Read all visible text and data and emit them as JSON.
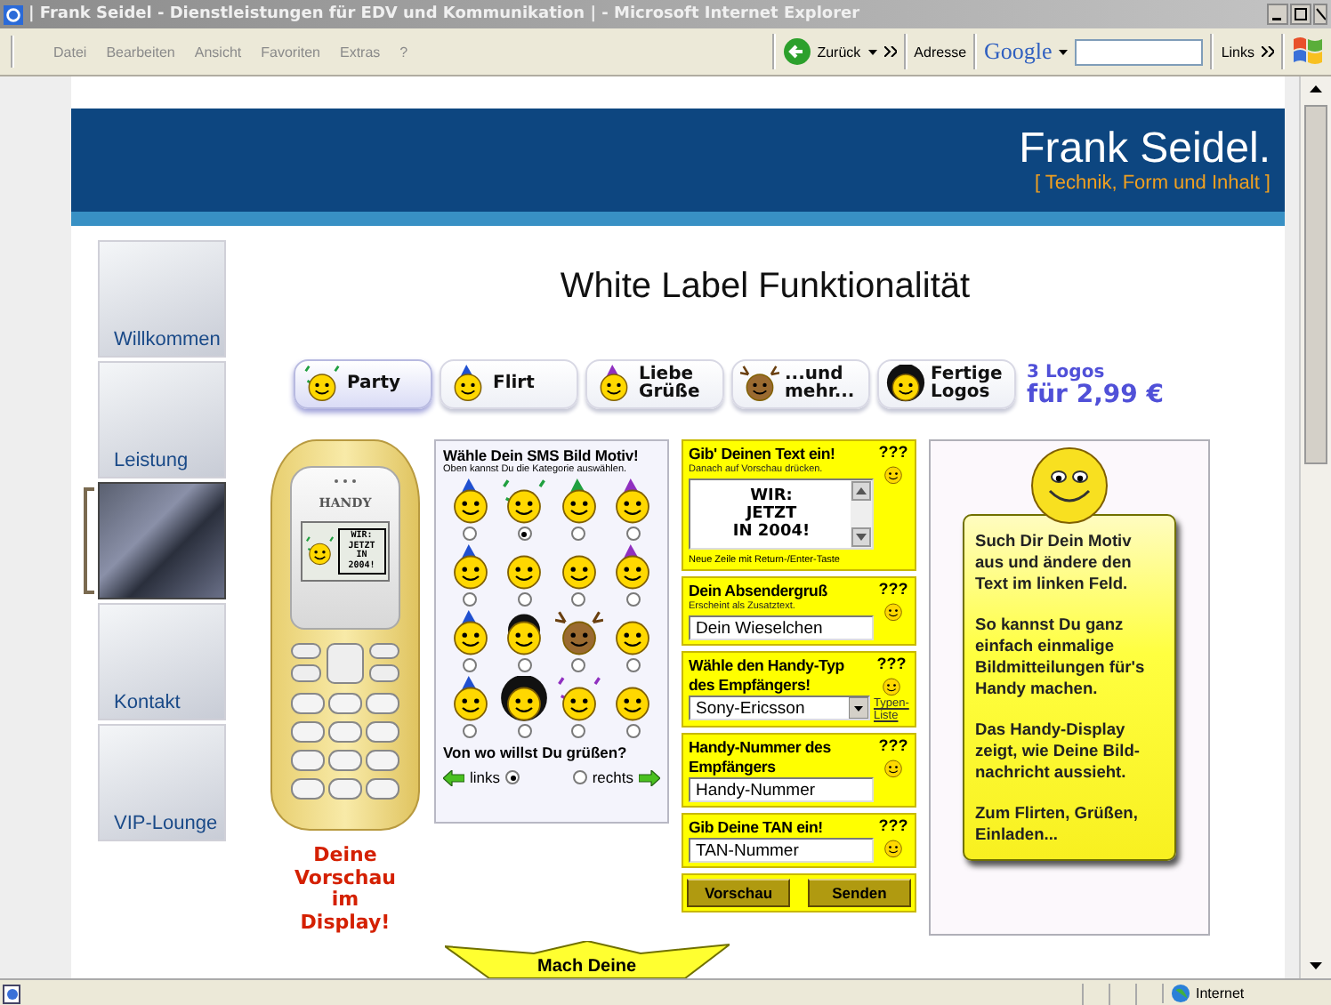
{
  "window": {
    "title": "| Frank Seidel - Dienstleistungen für EDV und Kommunikation | - Microsoft Internet Explorer"
  },
  "menu": [
    "Datei",
    "Bearbeiten",
    "Ansicht",
    "Favoriten",
    "Extras",
    "?"
  ],
  "toolbar": {
    "back": "Zurück",
    "address_label": "Adresse",
    "search_brand": "Google",
    "links": "Links"
  },
  "header": {
    "title": "Frank Seidel.",
    "tagline": "[ Technik, Form und Inhalt ]"
  },
  "nav": [
    {
      "label": "Willkommen",
      "selected": false
    },
    {
      "label": "Leistung",
      "selected": false
    },
    {
      "selected": true
    },
    {
      "label": "Kontakt",
      "selected": false
    },
    {
      "label": "VIP-Lounge",
      "selected": false
    }
  ],
  "heading": "White Label Funktionalität",
  "tabs": [
    {
      "label": "Party",
      "selected": true
    },
    {
      "label": "Flirt",
      "selected": false
    },
    {
      "label": "Liebe\nGrüße",
      "selected": false
    },
    {
      "label": "...und\nmehr...",
      "selected": false
    },
    {
      "label": "Fertige\nLogos",
      "selected": false
    }
  ],
  "offer": {
    "line_1": "3 Logos",
    "line_2": "für 2,99 €"
  },
  "phone": {
    "brand": "HANDY",
    "screen_text": "WIR:\nJETZT\nIN 2004!",
    "caption": "Deine\nVorschau\nim\nDisplay!"
  },
  "motif": {
    "title": "Wähle Dein SMS Bild Motiv!",
    "hint": "Oben kannst Du die Kategorie auswählen.",
    "options": [
      {
        "selected": false
      },
      {
        "selected": true
      },
      {
        "selected": false
      },
      {
        "selected": false
      },
      {
        "selected": false
      },
      {
        "selected": false
      },
      {
        "selected": false
      },
      {
        "selected": false
      },
      {
        "selected": false
      },
      {
        "selected": false
      },
      {
        "selected": false
      },
      {
        "selected": false
      },
      {
        "selected": false
      },
      {
        "selected": false
      },
      {
        "selected": false
      },
      {
        "selected": false
      }
    ],
    "direction_question": "Von wo willst Du grüßen?",
    "directions": [
      {
        "label": "links",
        "selected": true
      },
      {
        "label": "rechts",
        "selected": false
      }
    ]
  },
  "form": {
    "sections": [
      {
        "kind": "textarea",
        "title": "Gib' Deinen Text ein!",
        "hint": "Danach auf Vorschau drücken.",
        "value": "WIR:\nJETZT\nIN 2004!",
        "note": "Neue Zeile mit Return-/Enter-Taste",
        "help": "???"
      },
      {
        "kind": "text",
        "title": "Dein Absendergruß",
        "hint": "Erscheint als Zusatztext.",
        "value": "Dein Wieselchen",
        "help": "???"
      },
      {
        "kind": "select",
        "title": "Wähle den Handy-Typ des Empfängers!",
        "value": "Sony-Ericsson",
        "link": "Typen-Liste",
        "help": "???"
      },
      {
        "kind": "text",
        "title": "Handy-Nummer des Empfängers",
        "value": "Handy-Nummer",
        "help": "???"
      },
      {
        "kind": "text",
        "title": "Gib Deine TAN ein!",
        "value": "TAN-Nummer",
        "help": "???"
      }
    ],
    "buttons": [
      "Vorschau",
      "Senden"
    ]
  },
  "info": {
    "paragraphs": [
      "Such Dir Dein Motiv aus und ändere den Text im linken Feld.",
      "So kannst Du ganz einfach einmalige Bildmitteilungen für's Handy machen.",
      "Das Handy-Display zeigt, wie Deine Bild-nachricht aussieht.",
      "Zum Flirten, Grüßen, Einladen..."
    ]
  },
  "banner": {
    "text": "Mach Deine"
  },
  "status_bar": {
    "zone": "Internet"
  }
}
